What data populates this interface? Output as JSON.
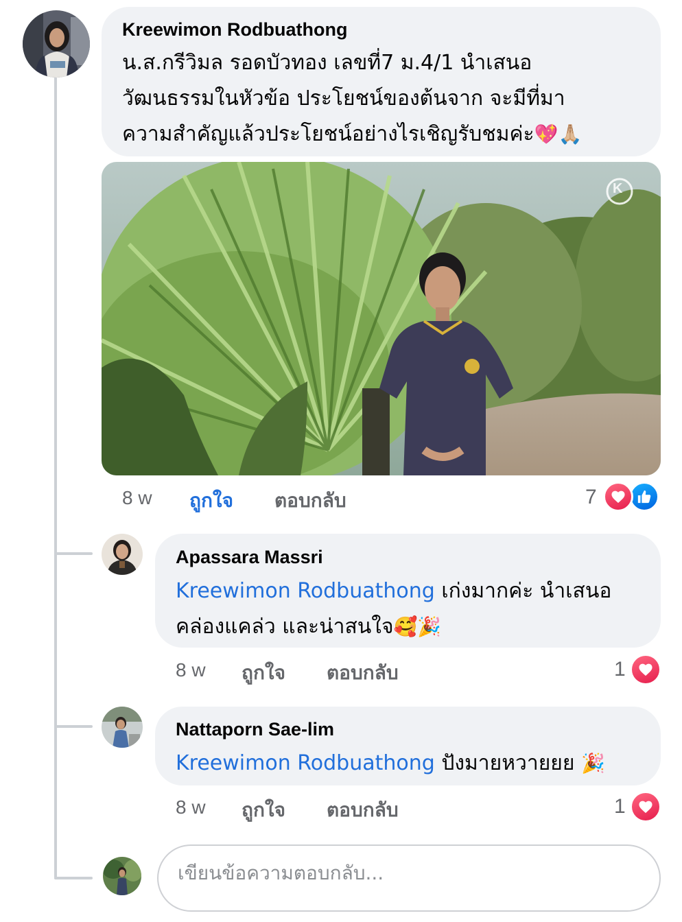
{
  "main_comment": {
    "author": "Kreewimon Rodbuathong",
    "lines": [
      "น.ส.กรีวิมล รอดบัวทอง เลขที่7 ม.4/1 นำเสนอ",
      "วัฒนธรรมในหัวข้อ ประโยชน์ของต้นจาก จะมีที่มา",
      "ความสำคัญแล้วประโยชน์อย่างไรเชิญรับชมค่ะ"
    ],
    "emojis": "💖🙏🏼",
    "time": "8 w",
    "like_label": "ถูกใจ",
    "reply_label": "ตอบกลับ",
    "reaction_count": "7",
    "reactions": [
      "heart-icon",
      "thumbs-up-icon"
    ],
    "video_watermark": "K"
  },
  "replies": [
    {
      "author": "Apassara Massri",
      "mention": "Kreewimon Rodbuathong",
      "text_line1": " เก่งมากค่ะ นำเสนอ",
      "text_line2": "คล่องแคล่ว และน่าสนใจ",
      "emojis": "🥰🎉",
      "time": "8 w",
      "like_label": "ถูกใจ",
      "reply_label": "ตอบกลับ",
      "reaction_count": "1"
    },
    {
      "author": "Nattaporn Sae-lim",
      "mention": "Kreewimon Rodbuathong",
      "text_line1": " ปังมายหวายยย ",
      "emojis": "🎉",
      "time": "8 w",
      "like_label": "ถูกใจ",
      "reply_label": "ตอบกลับ",
      "reaction_count": "1"
    }
  ],
  "reply_input": {
    "placeholder": "เขียนข้อความตอบกลับ...",
    "value": ""
  },
  "colors": {
    "bubble": "#f0f2f5",
    "link_blue": "#216fdb",
    "meta_gray": "#65676b",
    "heart_red": "#f33e58",
    "like_blue": "#1877f2"
  }
}
